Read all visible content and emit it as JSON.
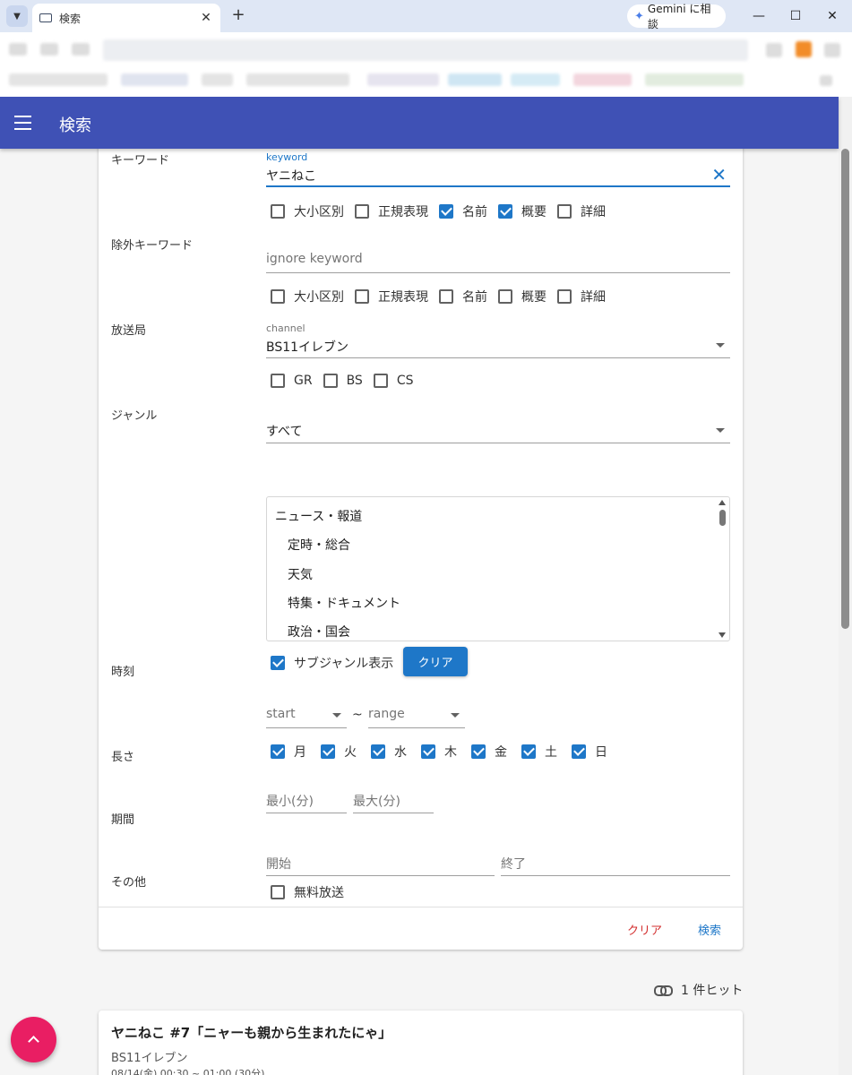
{
  "browser": {
    "tab_title": "検索",
    "tab_close": "✕",
    "new_tab": "+",
    "gemini_label": "Gemini に相談",
    "minimize": "—",
    "maximize": "☐",
    "close": "✕"
  },
  "appbar": {
    "title": "検索"
  },
  "form": {
    "keyword": {
      "row_label": "キーワード",
      "field_label": "keyword",
      "value": "ヤニねこ",
      "options": [
        {
          "label": "大小区別",
          "checked": false
        },
        {
          "label": "正規表現",
          "checked": false
        },
        {
          "label": "名前",
          "checked": true
        },
        {
          "label": "概要",
          "checked": true
        },
        {
          "label": "詳細",
          "checked": false
        }
      ]
    },
    "ignore_keyword": {
      "row_label": "除外キーワード",
      "placeholder": "ignore keyword",
      "options": [
        {
          "label": "大小区別",
          "checked": false
        },
        {
          "label": "正規表現",
          "checked": false
        },
        {
          "label": "名前",
          "checked": false
        },
        {
          "label": "概要",
          "checked": false
        },
        {
          "label": "詳細",
          "checked": false
        }
      ]
    },
    "channel": {
      "row_label": "放送局",
      "field_label": "channel",
      "value": "BS11イレブン",
      "types": [
        {
          "label": "GR",
          "checked": false
        },
        {
          "label": "BS",
          "checked": false
        },
        {
          "label": "CS",
          "checked": false
        }
      ]
    },
    "genre": {
      "row_label": "ジャンル",
      "value": "すべて",
      "list": [
        "ニュース・報道",
        "定時・総合",
        "天気",
        "特集・ドキュメント",
        "政治・国会"
      ],
      "subgenre_label": "サブジャンル表示",
      "subgenre_checked": true,
      "clear_button": "クリア"
    },
    "time": {
      "row_label": "時刻",
      "start_placeholder": "start",
      "separator": "~",
      "range_placeholder": "range",
      "days": [
        {
          "label": "月",
          "checked": true
        },
        {
          "label": "火",
          "checked": true
        },
        {
          "label": "水",
          "checked": true
        },
        {
          "label": "木",
          "checked": true
        },
        {
          "label": "金",
          "checked": true
        },
        {
          "label": "土",
          "checked": true
        },
        {
          "label": "日",
          "checked": true
        }
      ]
    },
    "length": {
      "row_label": "長さ",
      "min_placeholder": "最小(分)",
      "max_placeholder": "最大(分)"
    },
    "period": {
      "row_label": "期間",
      "start_placeholder": "開始",
      "end_placeholder": "終了"
    },
    "other": {
      "row_label": "その他",
      "free_label": "無料放送",
      "free_checked": false
    },
    "actions": {
      "clear": "クリア",
      "search": "検索"
    }
  },
  "results": {
    "hit_count": "1 件ヒット",
    "items": [
      {
        "title": "ヤニねこ #7「ニャーも親から生まれたにゃ」",
        "channel": "BS11イレブン",
        "time": "08/14(金) 00:30 ~ 01:00 (30分)"
      }
    ]
  },
  "colors": {
    "appbar": "#3f51b5",
    "accent": "#1e77c8",
    "fab": "#e91e63",
    "clear_action": "#d32f2f"
  },
  "icons": {
    "menu": "hamburger-icon",
    "clear_input": "close-icon",
    "dropdown": "triangle-down-icon",
    "link": "link-icon",
    "fab": "chevron-up-icon"
  }
}
